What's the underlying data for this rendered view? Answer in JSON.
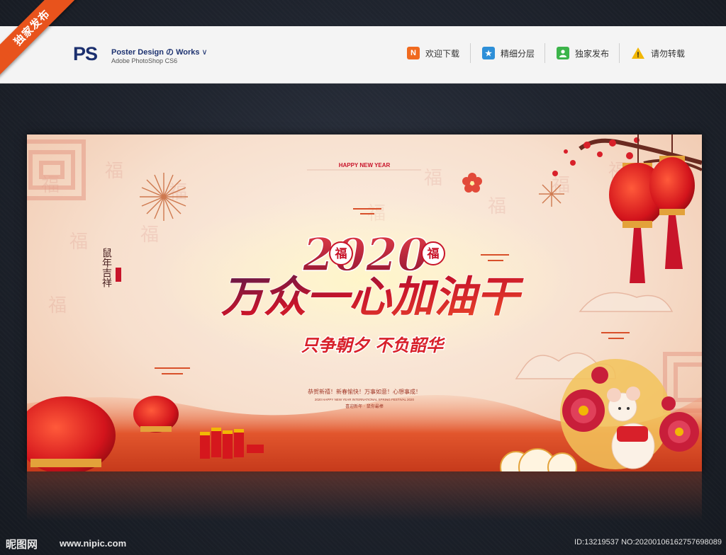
{
  "badge": {
    "label": "独家发布"
  },
  "header": {
    "logo": "PS",
    "title": "Poster Design の Works",
    "title_chevron": "∨",
    "subtitle": "Adobe PhotoShop CS6",
    "nav": [
      {
        "label": "欢迎下载",
        "icon": "n-icon",
        "icon_text": "N",
        "color": "#f06a1f"
      },
      {
        "label": "精细分层",
        "icon": "star-icon",
        "icon_text": "★",
        "color": "#2d8fd8"
      },
      {
        "label": "独家发布",
        "icon": "user-icon",
        "icon_text": "",
        "color": "#3cb44a"
      },
      {
        "label": "请勿转载",
        "icon": "warning-icon",
        "icon_text": "!",
        "color": "#f2b705"
      }
    ]
  },
  "poster": {
    "happy_new_year": "HAPPY NEW YEAR",
    "year": "2020",
    "fu_char": "福",
    "headline": "万众一心加油干",
    "subheadline": "只争朝夕  不负韶华",
    "seal_text": "鼠年吉祥",
    "greeting": "恭贺新禧！新春愉快！万事如意！心想事成！",
    "small_line": "2020 HAPPY NEW YEAR INTERNATIONAL SPRING FESTIVAL 2020",
    "small_line2": "喜迎新年 · 鼠你最棒",
    "colors": {
      "accent_red": "#c8142a",
      "gold": "#e3a23a",
      "paper": "#f7dfcd"
    }
  },
  "footer": {
    "site_cn": "昵图网",
    "site_url": "www.nipic.com",
    "id_text": "ID:13219537 NO:20200106162757698089"
  }
}
